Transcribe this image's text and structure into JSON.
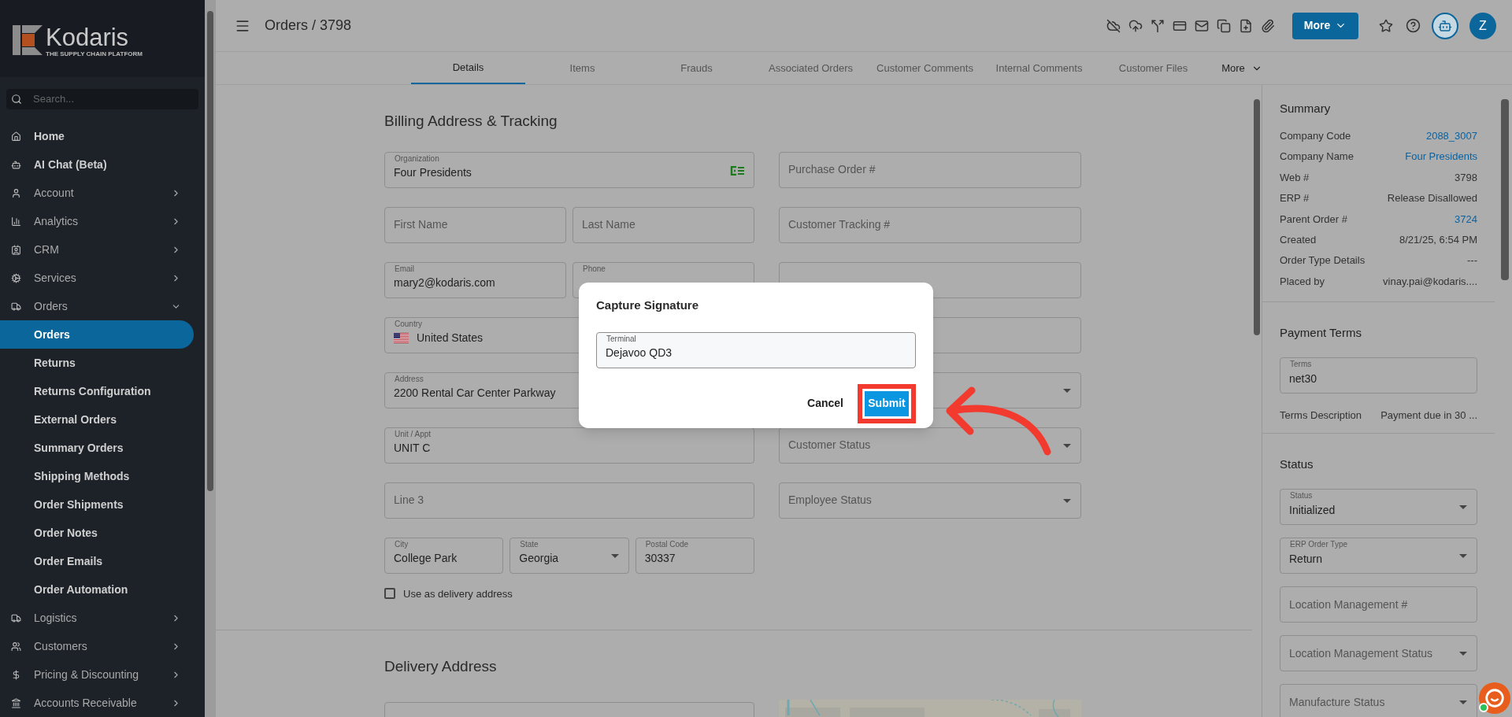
{
  "sidebar": {
    "logo": {
      "name": "Kodaris",
      "tagline": "THE SUPPLY CHAIN PLATFORM"
    },
    "search": {
      "placeholder": "Search..."
    },
    "items": [
      {
        "label": "Home",
        "selected": false
      },
      {
        "label": "AI Chat (Beta)",
        "selected": false
      },
      {
        "label": "Account",
        "selected": false,
        "expanded": false
      },
      {
        "label": "Analytics",
        "selected": false,
        "expanded": false
      },
      {
        "label": "CRM",
        "selected": false,
        "expanded": false
      },
      {
        "label": "Services",
        "selected": false,
        "expanded": false
      },
      {
        "label": "Orders",
        "selected": false,
        "expanded": true,
        "children": [
          {
            "label": "Orders",
            "selected": true
          },
          {
            "label": "Returns",
            "selected": false
          },
          {
            "label": "Returns Configuration",
            "selected": false
          },
          {
            "label": "External Orders",
            "selected": false
          },
          {
            "label": "Summary Orders",
            "selected": false
          },
          {
            "label": "Shipping Methods",
            "selected": false
          },
          {
            "label": "Order Shipments",
            "selected": false
          },
          {
            "label": "Order Notes",
            "selected": false
          },
          {
            "label": "Order Emails",
            "selected": false
          },
          {
            "label": "Order Automation",
            "selected": false
          }
        ]
      },
      {
        "label": "Logistics",
        "selected": false,
        "expanded": false
      },
      {
        "label": "Customers",
        "selected": false,
        "expanded": false
      },
      {
        "label": "Pricing & Discounting",
        "selected": false,
        "expanded": false
      },
      {
        "label": "Accounts Receivable",
        "selected": false,
        "expanded": false
      }
    ]
  },
  "header": {
    "title": "Orders / 3798",
    "more_button": "More",
    "avatar": "Z"
  },
  "tabs": [
    {
      "label": "Details",
      "selected": true,
      "kind": "tab"
    },
    {
      "label": "Items",
      "selected": false,
      "kind": "tab"
    },
    {
      "label": "Frauds",
      "selected": false,
      "kind": "tab"
    },
    {
      "label": "Associated Orders",
      "selected": false,
      "kind": "tab"
    },
    {
      "label": "Customer Comments",
      "selected": false,
      "kind": "tab"
    },
    {
      "label": "Internal Comments",
      "selected": false,
      "kind": "tab"
    },
    {
      "label": "Customer Files",
      "selected": false,
      "kind": "tab"
    },
    {
      "label": "More",
      "selected": false,
      "kind": "menu"
    }
  ],
  "billing": {
    "title": "Billing Address & Tracking",
    "left_rows": [
      [
        {
          "kind": "lookup",
          "label": "Organization",
          "value": "Four Presidents"
        }
      ],
      [
        {
          "kind": "text",
          "placeholder": "First Name"
        },
        {
          "kind": "text",
          "placeholder": "Last Name"
        }
      ],
      [
        {
          "kind": "text",
          "label": "Email",
          "value": "mary2@kodaris.com"
        },
        {
          "kind": "text",
          "label": "Phone"
        }
      ],
      [
        {
          "kind": "country",
          "label": "Country",
          "value": "United States"
        }
      ],
      [
        {
          "kind": "text",
          "label": "Address",
          "value": "2200 Rental Car Center Parkway"
        }
      ],
      [
        {
          "kind": "text",
          "label": "Unit / Appt",
          "value": "UNIT C"
        }
      ],
      [
        {
          "kind": "text",
          "placeholder": "Line 3"
        }
      ],
      [
        {
          "kind": "text",
          "label": "City",
          "value": "College Park"
        },
        {
          "kind": "select",
          "label": "State",
          "value": "Georgia"
        },
        {
          "kind": "text",
          "label": "Postal Code",
          "value": "30337"
        }
      ]
    ],
    "right_fields": [
      {
        "kind": "text",
        "placeholder": "Purchase Order #"
      },
      {
        "kind": "text",
        "placeholder": "Customer Tracking #"
      },
      {
        "kind": "text"
      },
      {
        "kind": "text"
      },
      {
        "kind": "select"
      },
      {
        "kind": "select",
        "placeholder": "Customer Status"
      },
      {
        "kind": "select",
        "placeholder": "Employee Status"
      }
    ],
    "checkbox": {
      "label": "Use as delivery address",
      "checked": false
    }
  },
  "delivery": {
    "title": "Delivery Address"
  },
  "summary": {
    "title": "Summary",
    "rows": [
      {
        "label": "Company Code",
        "value": "2088_3007",
        "link": true
      },
      {
        "label": "Company Name",
        "value": "Four Presidents",
        "link": true
      },
      {
        "label": "Web #",
        "value": "3798",
        "link": false
      },
      {
        "label": "ERP #",
        "value": "Release Disallowed",
        "link": false
      },
      {
        "label": "Parent Order #",
        "value": "3724",
        "link": true
      },
      {
        "label": "Created",
        "value": "8/21/25, 6:54 PM",
        "link": false
      },
      {
        "label": "Order Type Details",
        "value": "---",
        "link": false
      },
      {
        "label": "Placed by",
        "value": "vinay.pai@kodaris....",
        "link": false
      }
    ]
  },
  "payment_terms": {
    "title": "Payment Terms",
    "field": {
      "kind": "text",
      "label": "Terms",
      "value": "net30"
    },
    "description": {
      "label": "Terms Description",
      "value": "Payment due in 30 ..."
    }
  },
  "status": {
    "title": "Status",
    "fields": [
      {
        "kind": "select",
        "label": "Status",
        "value": "Initialized"
      },
      {
        "kind": "select",
        "label": "ERP Order Type",
        "value": "Return"
      },
      {
        "kind": "text",
        "placeholder": "Location Management #"
      },
      {
        "kind": "select",
        "placeholder": "Location Management Status"
      },
      {
        "kind": "select",
        "placeholder": "Manufacture Status"
      }
    ]
  },
  "modal": {
    "title": "Capture Signature",
    "field": {
      "kind": "text",
      "label": "Terminal",
      "value": "Dejavoo QD3"
    },
    "cancel": "Cancel",
    "submit": "Submit"
  }
}
